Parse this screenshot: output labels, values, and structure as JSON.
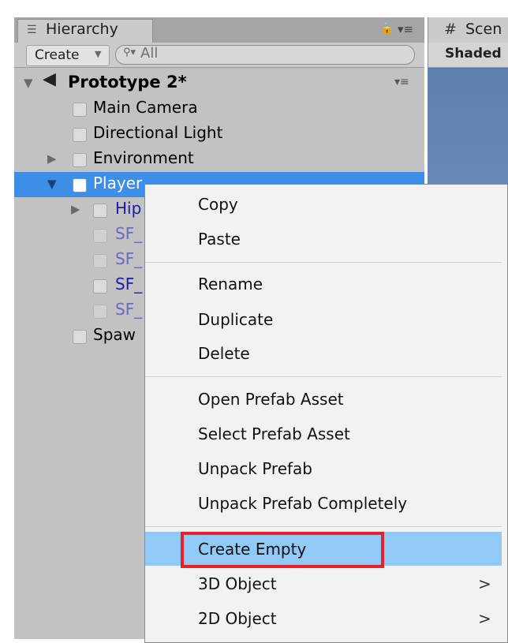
{
  "hierarchy": {
    "tab_label": "Hierarchy",
    "create_label": "Create",
    "search_placeholder": "All",
    "scene_title": "Prototype 2*",
    "items": [
      {
        "label": "Main Camera"
      },
      {
        "label": "Directional Light"
      },
      {
        "label": "Environment"
      },
      {
        "label": "Player"
      },
      {
        "label": "Hip"
      },
      {
        "label": "SF_"
      },
      {
        "label": "SF_"
      },
      {
        "label": "SF_"
      },
      {
        "label": "SF_"
      },
      {
        "label": "Spaw"
      }
    ]
  },
  "scene": {
    "tab_label": "Scen",
    "shading_mode": "Shaded"
  },
  "context_menu": {
    "items": [
      {
        "label": "Copy"
      },
      {
        "label": "Paste"
      },
      {
        "label": "Rename"
      },
      {
        "label": "Duplicate"
      },
      {
        "label": "Delete"
      },
      {
        "label": "Open Prefab Asset"
      },
      {
        "label": "Select Prefab Asset"
      },
      {
        "label": "Unpack Prefab"
      },
      {
        "label": "Unpack Prefab Completely"
      },
      {
        "label": "Create Empty"
      },
      {
        "label": "3D Object"
      },
      {
        "label": "2D Object"
      }
    ],
    "submenu_arrow": ">"
  },
  "colors": {
    "selection": "#3d8ee6",
    "menu_highlight": "#91c9f7",
    "annotation": "#e8202a",
    "prefab_text": "#1c1ca8"
  }
}
